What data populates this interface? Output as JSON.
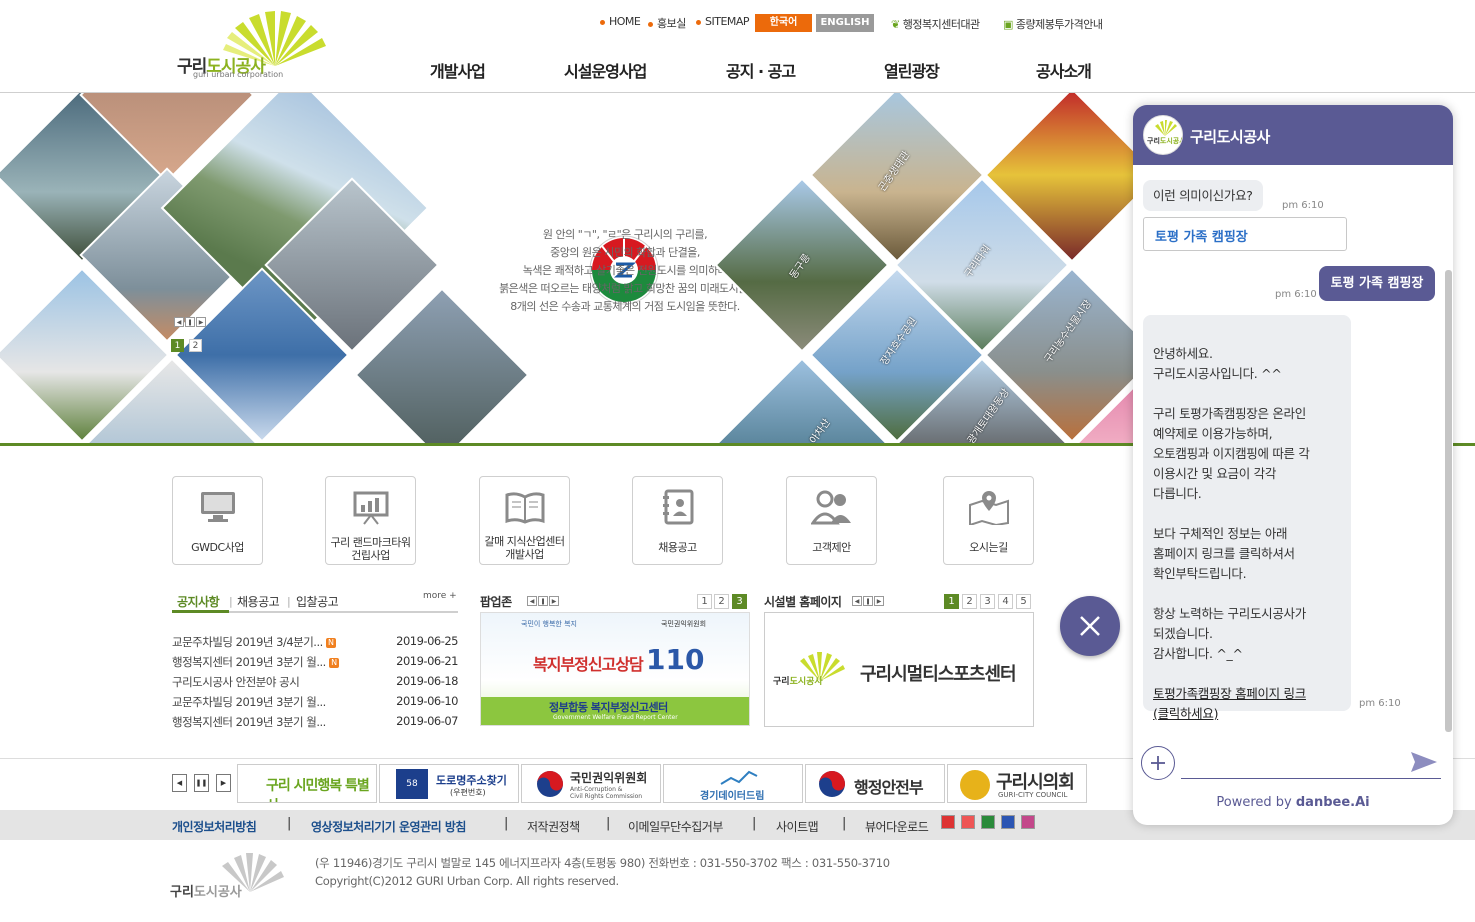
{
  "header": {
    "logo_text_a": "구리",
    "logo_text_b": "도시공사",
    "logo_sub": "guri urban corporation",
    "util": [
      "HOME",
      "홍보실",
      "SITEMAP"
    ],
    "lang_ko": "한국어",
    "lang_en": "ENGLISH",
    "link1": "행정복지센터대관",
    "link2": "종량제봉투가격안내",
    "gnb": [
      "개발사업",
      "시설운영사업",
      "공지 · 공고",
      "열린광장",
      "공사소개"
    ]
  },
  "hero": {
    "motto": [
      "원 안의 \"ㄱ\", \"ㄹ\"은 구리시의 구리를,",
      "중앙의 원은 시민의 화합과 단결을,",
      "녹색은 쾌적하고 살기좋은 전원도시를 의미하며",
      "붉은색은 떠오르는 태양처럼 밝고 희망찬 꿈의 미래도시를,",
      "8개의 선은 수송과 교통체계의 거점 도시임을 뜻한다."
    ],
    "captions": [
      "곤충생태관",
      "동구릉",
      "구리타워",
      "장자호수공원",
      "구리농수산물시장",
      "아차산",
      "광개토대왕동상"
    ],
    "pages": [
      "1",
      "2"
    ],
    "pages_active": "1"
  },
  "quick": [
    {
      "label": "GWDC사업",
      "icon": "monitor-icon"
    },
    {
      "label": "구리 랜드마크타워\n건립사업",
      "icon": "presentation-board-icon"
    },
    {
      "label": "갈매 지식산업센터\n개발사업",
      "icon": "open-book-icon"
    },
    {
      "label": "채용공고",
      "icon": "notebook-icon"
    },
    {
      "label": "고객제안",
      "icon": "people-icon"
    },
    {
      "label": "오시는길",
      "icon": "map-pin-icon"
    }
  ],
  "notice": {
    "tabs": [
      "공지사항",
      "채용공고",
      "입찰공고"
    ],
    "more": "more +",
    "rows": [
      {
        "title": "교문주차빌딩 2019년 3/4분기...",
        "date": "2019-06-25",
        "new": "N"
      },
      {
        "title": "행정복지센터 2019년 3분기 월...",
        "date": "2019-06-21",
        "new": "N"
      },
      {
        "title": "구리도시공사 안전분야 공시",
        "date": "2019-06-18",
        "new": ""
      },
      {
        "title": "교문주차빌딩 2019년 3분기 월...",
        "date": "2019-06-10",
        "new": ""
      },
      {
        "title": "행정복지센터 2019년 3분기 월...",
        "date": "2019-06-07",
        "new": ""
      }
    ]
  },
  "popup": {
    "title": "팝업존",
    "pages": [
      "1",
      "2",
      "3"
    ],
    "active": "3",
    "banner_top": "국민이 행복한 복지",
    "banner_org": "국민권익위원회",
    "banner_main": "복지부정신고상담",
    "banner_num": "110",
    "banner_sub": "정부합동 복지부정신고센터",
    "banner_en": "Government Welfare Fraud Report Center"
  },
  "facility": {
    "title": "시설별 홈페이지",
    "pages": [
      "1",
      "2",
      "3",
      "4",
      "5"
    ],
    "active": "1",
    "name": "구리시멀티스포츠센터",
    "logo_a": "구리",
    "logo_b": "도시공사"
  },
  "banners": {
    "b1": "구리 시민행복 특별시",
    "b2_a": "도로명주소찾기",
    "b2_b": "(우편번호)",
    "b3_a": "국민권익위원회",
    "b3_b": "Anti-Corruption &",
    "b3_c": "Civil Rights Commission",
    "b4": "경기데이터드림",
    "b5": "행정안전부",
    "b6_a": "구리시의회",
    "b6_b": "GURI-CITY COUNCIL"
  },
  "footer": {
    "links": [
      "개인정보처리방침",
      "영상정보처리기기 운영관리 방침",
      "저작권정책",
      "이메일무단수집거부",
      "사이트맵",
      "뷰어다운로드"
    ],
    "address": "(우 11946)경기도 구리시 벌말로 145 에너지프라자 4층(토평동 980)  전화번호 : 031-550-3702    팩스 : 031-550-3710",
    "copyright": "Copyright(C)2012 GURI Urban Corp. All rights reserved.",
    "logo_a": "구리",
    "logo_b": "도시공사"
  },
  "chat": {
    "title": "구리도시공사",
    "q1": "이런 의미이신가요?",
    "t1": "pm 6:10",
    "option": "토평 가족 캠핑장",
    "user_msg": "토평 가족 캠핑장",
    "t2": "pm 6:10",
    "answer": [
      "안녕하세요.",
      "구리도시공사입니다. ^^",
      "",
      "구리 토평가족캠핑장은 온라인",
      "예약제로 이용가능하며,",
      "오토캠핑과 이지캠핑에 따른 각",
      "이용시간 및 요금이 각각",
      "다릅니다.",
      "",
      "보다 구체적인 정보는 아래",
      "홈페이지 링크를 클릭하셔서",
      "확인부탁드립니다.",
      "",
      "항상 노력하는 구리도시공사가",
      "되겠습니다.",
      "감사합니다. ^_^",
      ""
    ],
    "link_a": "토평가족캠핑장 홈페이지 링크",
    "link_b": "(클릭하세요)",
    "t3": "pm 6:10",
    "powered_a": "Powered by ",
    "powered_b": "danbee.Ai",
    "colors": {
      "brand": "#5a5a94",
      "green": "#5d8a25"
    }
  }
}
